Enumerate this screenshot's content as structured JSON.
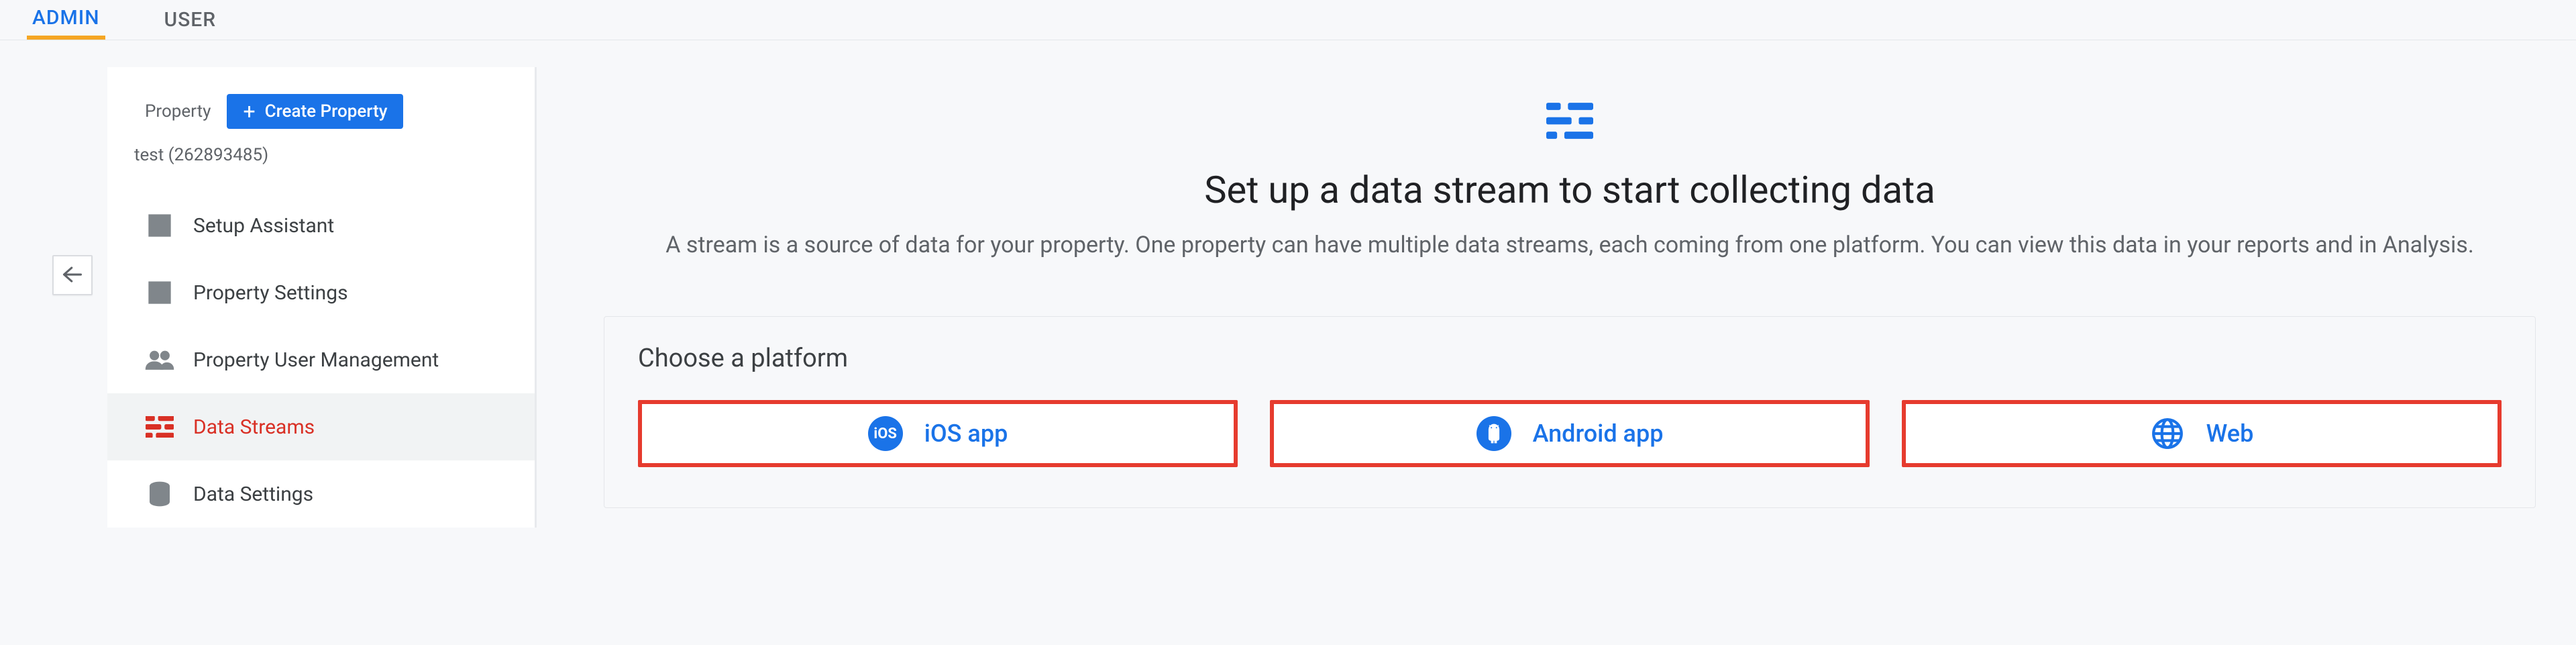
{
  "tabs": {
    "admin": "ADMIN",
    "user": "USER"
  },
  "sidebar": {
    "property_label": "Property",
    "create_property_label": "Create Property",
    "property_name": "test (262893485)",
    "items": [
      {
        "label": "Setup Assistant"
      },
      {
        "label": "Property Settings"
      },
      {
        "label": "Property User Management"
      },
      {
        "label": "Data Streams"
      },
      {
        "label": "Data Settings"
      }
    ]
  },
  "main": {
    "title": "Set up a data stream to start collecting data",
    "subtitle": "A stream is a source of data for your property. One property can have multiple data streams, each coming from one platform. You can view this data in your reports and in Analysis.",
    "choose_label": "Choose a platform",
    "platforms": {
      "ios": "iOS app",
      "android": "Android app",
      "web": "Web"
    }
  },
  "colors": {
    "accent": "#1a73e8",
    "highlight_border": "#e63b2e",
    "active_text": "#d93025"
  }
}
